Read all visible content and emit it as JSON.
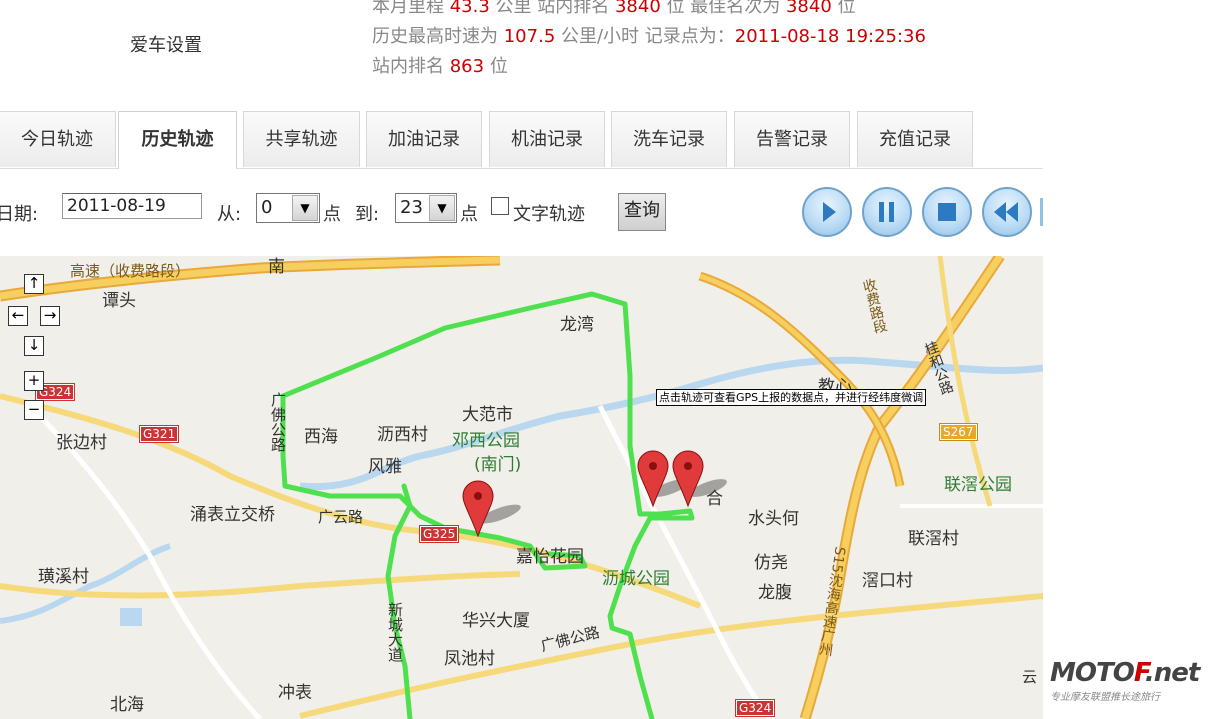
{
  "header": {
    "menu_item": "爱车设置",
    "line1": {
      "prefix": "本月里程 ",
      "mileage": "43.3",
      "mid": " 公里   站内排名 ",
      "rank": "3840",
      "mid2": " 位   最佳名次为 ",
      "best": "3840",
      "suffix": " 位"
    },
    "line2": {
      "prefix": "历史最高时速为 ",
      "speed": "107.5",
      "mid": " 公里/小时   记录点为：",
      "time": "2011-08-18 19:25:36"
    },
    "line3": {
      "prefix": "站内排名 ",
      "rank": "863",
      "suffix": " 位"
    }
  },
  "tabs": [
    "今日轨迹",
    "历史轨迹",
    "共享轨迹",
    "加油记录",
    "机油记录",
    "洗车记录",
    "告警记录",
    "充值记录"
  ],
  "active_tab": "历史轨迹",
  "query": {
    "date_label": "日期:",
    "date_value": "2011-08-19",
    "from_label": "从:",
    "from_value": "0",
    "hour_unit": "点",
    "to_label": "到:",
    "to_value": "23",
    "text_track_label": "文字轨迹",
    "query_button": "查询"
  },
  "playback_controls": [
    "play-icon",
    "pause-icon",
    "stop-icon",
    "rewind-icon"
  ],
  "map": {
    "tooltip": "点击轨迹可查看GPS上报的数据点，并进行经纬度微调",
    "labels": {
      "tanTou": "谭头",
      "longWan": "龙湾",
      "daFanShi": "大范市",
      "xiHai": "西海",
      "liXiCun": "沥西村",
      "dengXiPark": "邓西公园",
      "nanMen": "(南门)",
      "fengYa": "风雅",
      "zhangBianCun": "张边村",
      "yongBiao": "涌表立交桥",
      "guangYunLu": "广云路",
      "jiaYi": "嘉怡花园",
      "huangXiCun": "璜溪村",
      "liChengPark": "沥城公园",
      "huaXing": "华兴大厦",
      "fengChiCun": "凤池村",
      "guangFoLu": "广佛公路",
      "chongBiao": "冲表",
      "beiHai": "北海",
      "shuiTouHe": "水头何",
      "fangYao": "仿尧",
      "longFu": "龙腹",
      "lianShengPark": "联滘公园",
      "lianShengCun": "联滘村",
      "jiaoKouCun": "滘口村",
      "jiaoXin": "教心",
      "xinChengDaDao": "新城大道",
      "guangFoGongLu": "广佛公路",
      "gaoSuTop": "高速（收费路段）",
      "nanTop": "南",
      "shenHai": "S15沈海高速广州",
      "shouFei": "收费路段",
      "guiHe": "桂和公路",
      "heRight": "合",
      "yun": "云",
      "chunCun": "村",
      "nan2": "南门",
      "g321": "G321",
      "g324a": "G324",
      "g324b": "G324",
      "g325": "G325",
      "s267": "S267"
    },
    "colors": {
      "track": "#4ee04e",
      "marker": "#e03a3a",
      "river": "#b9d8f0",
      "highway": "#f2c24a"
    }
  },
  "watermark": {
    "main_a": "MOTO",
    "main_b": "F",
    "main_c": ".net",
    "sub": "专业摩友联盟推长途旅行"
  }
}
